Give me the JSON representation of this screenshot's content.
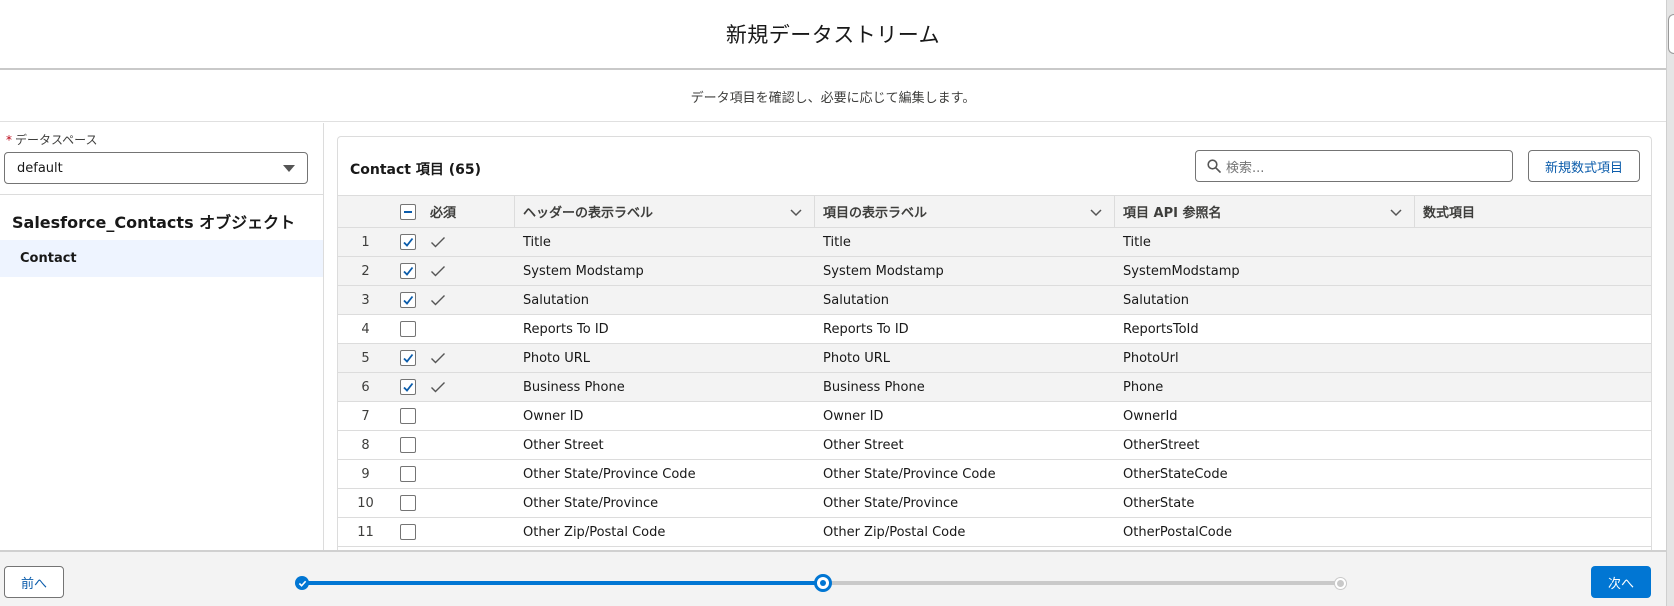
{
  "modal": {
    "title": "新規データストリーム",
    "subtitle": "データ項目を確認し、必要に応じて編集します。"
  },
  "left_panel": {
    "dataspace_label": "データスペース",
    "dataspace_required_marker": "*",
    "dataspace_value": "default",
    "object_title": "Salesforce_Contacts オブジェクト",
    "objects": [
      {
        "label": "Contact",
        "selected": true
      }
    ]
  },
  "fields_card": {
    "title": "Contact 項目 (65)",
    "search_placeholder": "検索...",
    "new_formula_button": "新規数式項目",
    "columns": {
      "required": "必須",
      "header_label": "ヘッダーの表示ラベル",
      "field_label": "項目の表示ラベル",
      "api_name": "項目 API 参照名",
      "formula": "数式項目"
    },
    "rows": [
      {
        "num": "1",
        "checked": true,
        "required": true,
        "header_label": "Title",
        "field_label": "Title",
        "api_name": "Title"
      },
      {
        "num": "2",
        "checked": true,
        "required": true,
        "header_label": "System Modstamp",
        "field_label": "System Modstamp",
        "api_name": "SystemModstamp"
      },
      {
        "num": "3",
        "checked": true,
        "required": true,
        "header_label": "Salutation",
        "field_label": "Salutation",
        "api_name": "Salutation"
      },
      {
        "num": "4",
        "checked": false,
        "required": false,
        "header_label": "Reports To ID",
        "field_label": "Reports To ID",
        "api_name": "ReportsToId"
      },
      {
        "num": "5",
        "checked": true,
        "required": true,
        "header_label": "Photo URL",
        "field_label": "Photo URL",
        "api_name": "PhotoUrl"
      },
      {
        "num": "6",
        "checked": true,
        "required": true,
        "header_label": "Business Phone",
        "field_label": "Business Phone",
        "api_name": "Phone"
      },
      {
        "num": "7",
        "checked": false,
        "required": false,
        "header_label": "Owner ID",
        "field_label": "Owner ID",
        "api_name": "OwnerId"
      },
      {
        "num": "8",
        "checked": false,
        "required": false,
        "header_label": "Other Street",
        "field_label": "Other Street",
        "api_name": "OtherStreet"
      },
      {
        "num": "9",
        "checked": false,
        "required": false,
        "header_label": "Other State/Province Code",
        "field_label": "Other State/Province Code",
        "api_name": "OtherStateCode"
      },
      {
        "num": "10",
        "checked": false,
        "required": false,
        "header_label": "Other State/Province",
        "field_label": "Other State/Province",
        "api_name": "OtherState"
      },
      {
        "num": "11",
        "checked": false,
        "required": false,
        "header_label": "Other Zip/Postal Code",
        "field_label": "Other Zip/Postal Code",
        "api_name": "OtherPostalCode"
      }
    ]
  },
  "footer": {
    "prev_button": "前へ",
    "next_button": "次へ",
    "progress": {
      "current_step": 2,
      "total_steps": 3,
      "fraction_complete": 0.5
    }
  },
  "colors": {
    "brand_blue": "#0176d3",
    "link_blue": "#0b5cab",
    "required_red": "#ba0517",
    "row_checked_bg": "#f3f3f3",
    "selected_object_bg": "#eef4ff"
  }
}
